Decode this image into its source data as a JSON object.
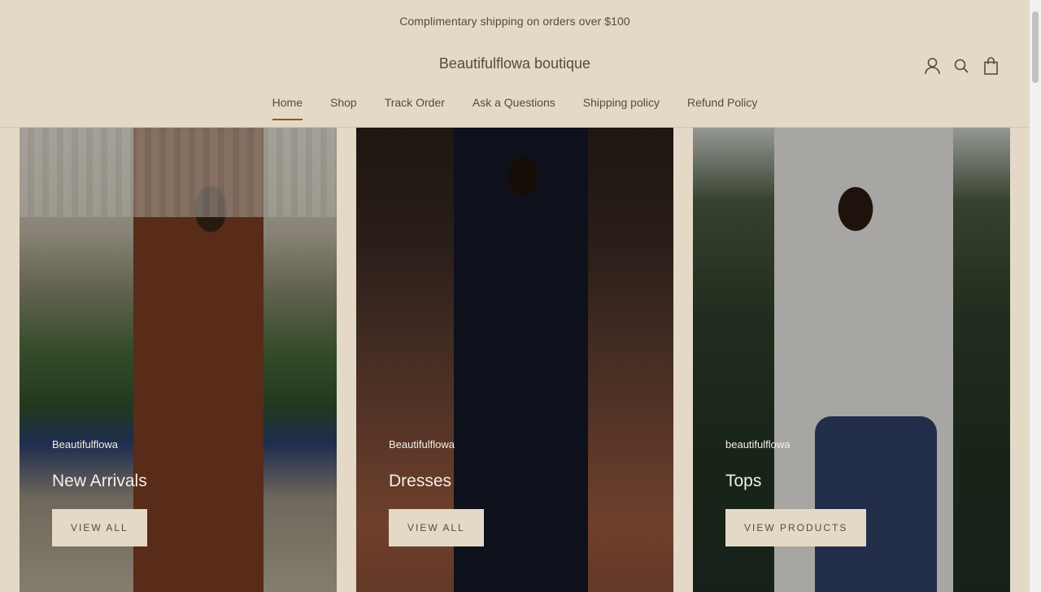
{
  "announcement": "Complimentary shipping on orders over $100",
  "header": {
    "logo": "Beautifulflowa boutique",
    "icons": [
      "account-icon",
      "search-icon",
      "cart-icon"
    ]
  },
  "nav": {
    "items": [
      {
        "label": "Home",
        "active": true
      },
      {
        "label": "Shop"
      },
      {
        "label": "Track Order"
      },
      {
        "label": "Ask a Questions"
      },
      {
        "label": "Shipping policy"
      },
      {
        "label": "Refund Policy"
      }
    ]
  },
  "collections": [
    {
      "subheading": "Beautifulflowa",
      "title": "New Arrivals",
      "button": "VIEW ALL"
    },
    {
      "subheading": "Beautifulflowa",
      "title": "Dresses",
      "button": "VIEW ALL"
    },
    {
      "subheading": "beautifulflowa",
      "title": "Tops",
      "button": "VIEW PRODUCTS"
    }
  ],
  "colors": {
    "background": "#e4d9c7",
    "text": "#5a4a33",
    "accent": "#8b5a2b"
  }
}
